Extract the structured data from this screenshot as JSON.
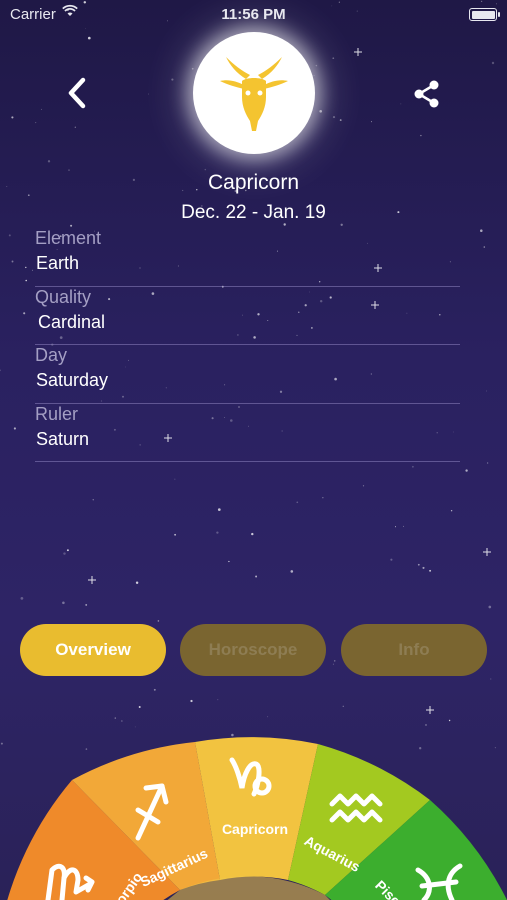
{
  "status_bar": {
    "carrier": "Carrier",
    "time": "11:56 PM"
  },
  "header": {
    "back_icon": "chevron-left-icon",
    "share_icon": "share-icon",
    "sign_symbol_icon": "capricorn-goat-icon",
    "accent_color": "#f4c430"
  },
  "sign": {
    "name": "Capricorn",
    "dates": "Dec. 22 - Jan. 19"
  },
  "properties": [
    {
      "label": "Element",
      "value": "Earth"
    },
    {
      "label": "Quality",
      "value": "Cardinal"
    },
    {
      "label": "Day",
      "value": "Saturday"
    },
    {
      "label": "Ruler",
      "value": "Saturn"
    }
  ],
  "tabs": [
    {
      "label": "Overview",
      "active": true
    },
    {
      "label": "Horoscope",
      "active": false
    },
    {
      "label": "Info",
      "active": false
    }
  ],
  "wheel": {
    "segments": [
      {
        "name": "Scorpio",
        "color": "#ef8a2a"
      },
      {
        "name": "Sagittarius",
        "color": "#f2a838"
      },
      {
        "name": "Capricorn",
        "color": "#f2c340"
      },
      {
        "name": "Aquarius",
        "color": "#a3c920"
      },
      {
        "name": "Pisces",
        "color": "#3cae2e"
      }
    ]
  }
}
